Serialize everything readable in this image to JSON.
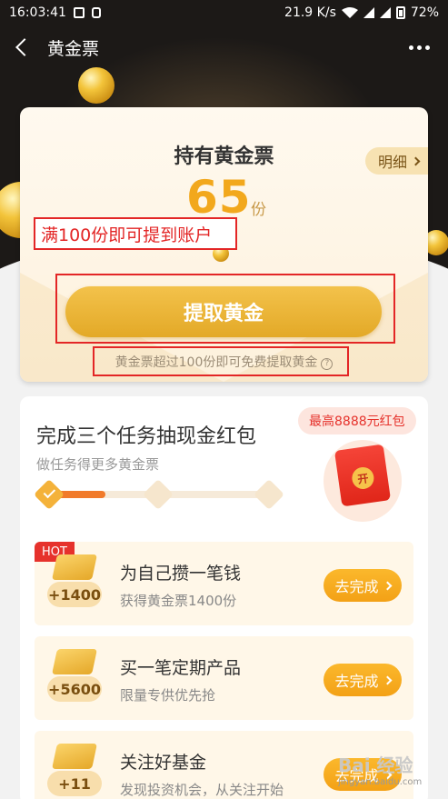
{
  "status_bar": {
    "time": "16:03:41",
    "speed": "21.9 K/s",
    "battery": "72%"
  },
  "nav": {
    "title": "黄金票"
  },
  "ticket": {
    "title": "持有黄金票",
    "detail_label": "明细",
    "count": "65",
    "unit": "份",
    "extract_button": "提取黄金",
    "tip": "黄金票超过100份即可免费提取黄金"
  },
  "annotation": {
    "label": "满100份即可提到账户"
  },
  "tasks": {
    "title": "完成三个任务抽现金红包",
    "subtitle": "做任务得更多黄金票",
    "max_badge": "最高8888元红包",
    "redpack_seal": "开",
    "progress": 0.28,
    "items": [
      {
        "badge": "HOT",
        "points": "+1400",
        "name": "为自己攒一笔钱",
        "desc": "获得黄金票1400份",
        "action": "去完成"
      },
      {
        "points": "+5600",
        "name": "买一笔定期产品",
        "desc": "限量专供优先抢",
        "action": "去完成"
      },
      {
        "points": "+11",
        "name": "关注好基金",
        "desc": "发现投资机会，从关注开始",
        "action": "去完成"
      }
    ]
  },
  "watermark": {
    "line1": "Bai 经验",
    "line2": "jingyan.baidu.com"
  },
  "colors": {
    "gold": "#f2a81d",
    "accent_red": "#e32626",
    "header_dark": "#1c1917"
  }
}
